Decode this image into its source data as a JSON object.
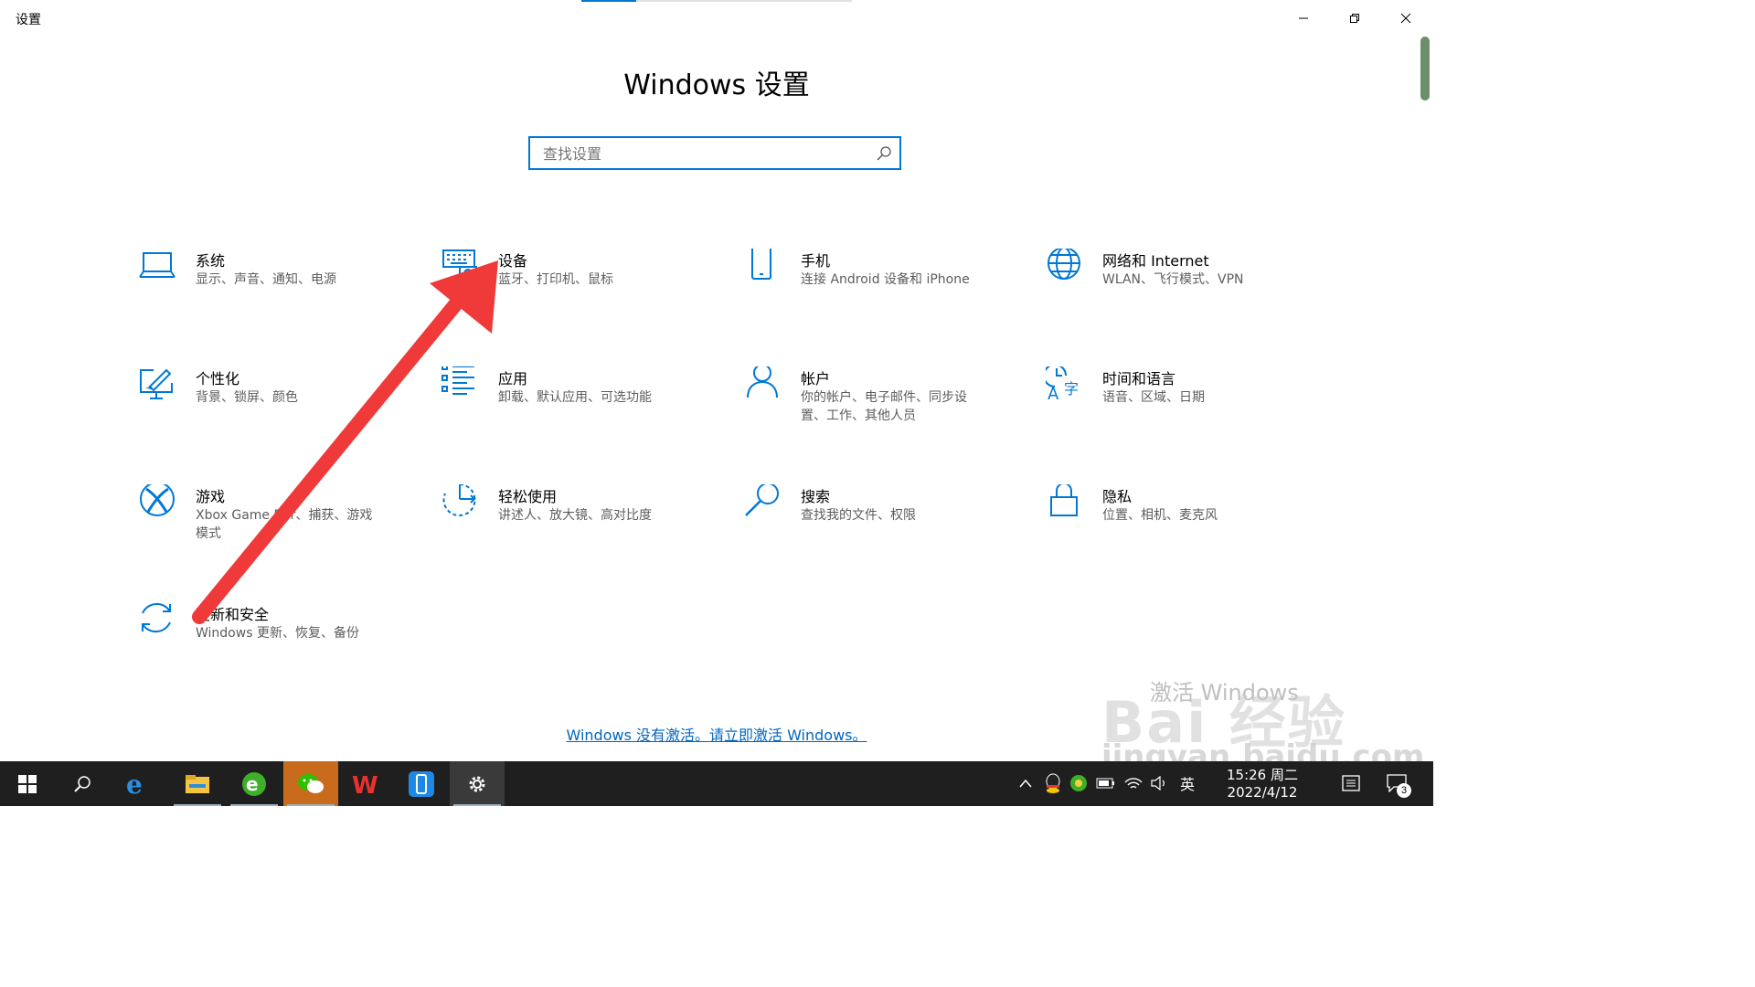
{
  "window": {
    "title": "设置",
    "controls": {
      "minimize": "minimize",
      "restore": "restore",
      "close": "close"
    }
  },
  "page": {
    "title": "Windows 设置",
    "search_placeholder": "查找设置"
  },
  "tiles": [
    {
      "id": "system",
      "title": "系统",
      "desc": "显示、声音、通知、电源",
      "icon": "laptop-icon"
    },
    {
      "id": "devices",
      "title": "设备",
      "desc": "蓝牙、打印机、鼠标",
      "icon": "keyboard-printer-icon"
    },
    {
      "id": "phone",
      "title": "手机",
      "desc": "连接 Android 设备和 iPhone",
      "icon": "phone-icon"
    },
    {
      "id": "network",
      "title": "网络和 Internet",
      "desc": "WLAN、飞行模式、VPN",
      "icon": "globe-icon"
    },
    {
      "id": "personalization",
      "title": "个性化",
      "desc": "背景、锁屏、颜色",
      "icon": "pen-monitor-icon"
    },
    {
      "id": "apps",
      "title": "应用",
      "desc": "卸载、默认应用、可选功能",
      "icon": "list-icon"
    },
    {
      "id": "accounts",
      "title": "帐户",
      "desc": "你的帐户、电子邮件、同步设置、工作、其他人员",
      "icon": "person-icon"
    },
    {
      "id": "time",
      "title": "时间和语言",
      "desc": "语音、区域、日期",
      "icon": "clock-language-icon"
    },
    {
      "id": "gaming",
      "title": "游戏",
      "desc": "Xbox Game Bar、捕获、游戏模式",
      "icon": "xbox-icon"
    },
    {
      "id": "ease",
      "title": "轻松使用",
      "desc": "讲述人、放大镜、高对比度",
      "icon": "ease-of-access-icon"
    },
    {
      "id": "search",
      "title": "搜索",
      "desc": "查找我的文件、权限",
      "icon": "magnifier-icon"
    },
    {
      "id": "privacy",
      "title": "隐私",
      "desc": "位置、相机、麦克风",
      "icon": "lock-icon"
    },
    {
      "id": "update",
      "title": "更新和安全",
      "desc": "Windows 更新、恢复、备份",
      "icon": "sync-icon"
    }
  ],
  "activation": {
    "link": "Windows 没有激活。请立即激活 Windows。",
    "watermark": "激活 Windows"
  },
  "watermark": {
    "brand": "Bai 经验",
    "url": "jingyan.baidu.com"
  },
  "taskbar": {
    "apps": [
      "start-icon",
      "search-icon",
      "edge-ie-icon",
      "file-explorer-icon",
      "browser-360-icon",
      "wechat-icon",
      "wps-icon",
      "phone-app-icon",
      "settings-icon"
    ],
    "ime": "英",
    "time": "15:26 周二",
    "date": "2022/4/12",
    "notification_count": "3"
  },
  "colors": {
    "accent": "#0078d4",
    "taskbar": "#1f1f1f",
    "arrow": "#f03a3a",
    "link": "#0067c0"
  }
}
